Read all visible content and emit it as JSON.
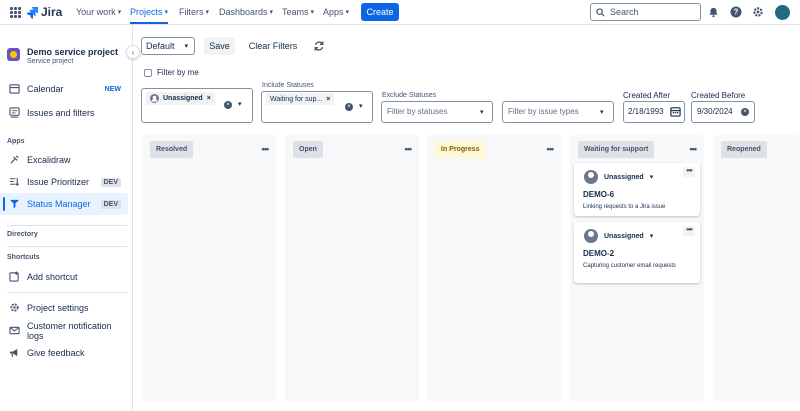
{
  "topnav": {
    "logo": "Jira",
    "items": [
      {
        "label": "Your work"
      },
      {
        "label": "Projects"
      },
      {
        "label": "Filters"
      },
      {
        "label": "Dashboards"
      },
      {
        "label": "Teams"
      },
      {
        "label": "Apps"
      }
    ],
    "create_label": "Create",
    "search_placeholder": "Search",
    "avatar_initial": "",
    "accent": "#0c66e4"
  },
  "sidebar": {
    "project_name": "Demo service project",
    "project_type": "Service project",
    "items": [
      {
        "label": "Calendar",
        "badge": "NEW",
        "icon": "calendar-icon"
      },
      {
        "label": "Issues and filters",
        "badge": "",
        "icon": "issues-icon"
      }
    ],
    "apps_heading": "Apps",
    "apps": [
      {
        "label": "Excalidraw",
        "badge": "",
        "icon": "excalidraw-icon"
      },
      {
        "label": "Issue Prioritizer",
        "badge": "DEV",
        "icon": "prioritizer-icon"
      },
      {
        "label": "Status Manager",
        "badge": "DEV",
        "icon": "status-manager-icon"
      }
    ],
    "directory_heading": "Directory",
    "shortcuts_heading": "Shortcuts",
    "add_shortcut": "Add shortcut",
    "footer": [
      {
        "label": "Project settings",
        "icon": "gear-icon"
      },
      {
        "label": "Customer notification logs",
        "icon": "mail-icon"
      },
      {
        "label": "Give feedback",
        "icon": "megaphone-icon"
      }
    ]
  },
  "toolbar": {
    "view_select": "Default",
    "save_label": "Save",
    "clear_label": "Clear Filters",
    "filter_by_me": "Filter by me"
  },
  "filters": {
    "assignee_chip": "Unassigned",
    "include_label": "Include Statuses",
    "include_chip": "Waiting for sup...",
    "exclude_label": "Exclude Statuses",
    "exclude_placeholder": "Filter by statuses",
    "issue_type_placeholder": "Filter by issue types",
    "created_after_label": "Created After",
    "created_after_value": "2/18/1993",
    "created_before_label": "Created Before",
    "created_before_value": "9/30/2024"
  },
  "board": {
    "columns": [
      {
        "title": "Resolved"
      },
      {
        "title": "Open"
      },
      {
        "title": "In Progress"
      },
      {
        "title": "Waiting for support"
      },
      {
        "title": "Reopened"
      }
    ],
    "cards": [
      {
        "assignee": "Unassigned",
        "key": "DEMO-6",
        "summary": "Linking requests to a Jira issue"
      },
      {
        "assignee": "Unassigned",
        "key": "DEMO-2",
        "summary": "Capturing customer email requests"
      }
    ]
  }
}
